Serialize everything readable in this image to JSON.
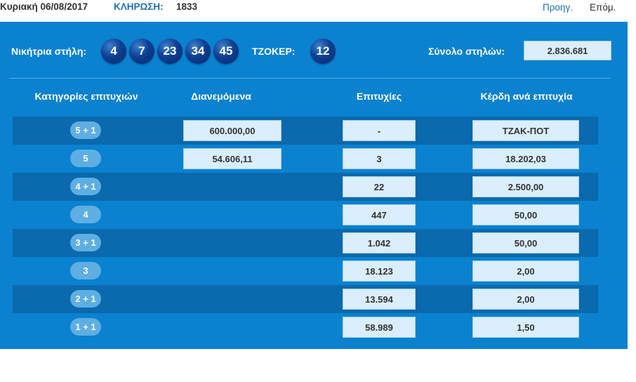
{
  "header": {
    "date": "Κυριακή 06/08/2017",
    "draw_label": "ΚΛΗΡΩΣΗ:",
    "draw_number": "1833",
    "prev_label": "Προηγ.",
    "next_label": "Επόμ."
  },
  "winning": {
    "label": "Νικήτρια στήλη:",
    "numbers": [
      "4",
      "7",
      "23",
      "34",
      "45"
    ],
    "joker_label": "ΤΖΟΚΕΡ:",
    "joker": "12",
    "total_label": "Σύνολο στηλών:",
    "total_value": "2.836.681"
  },
  "table": {
    "headers": [
      "Κατηγορίες επιτυχιών",
      "Διανεμόμενα",
      "Επιτυχίες",
      "Κέρδη ανά επιτυχία"
    ],
    "rows": [
      {
        "category": "5 + 1",
        "distributed": "600.000,00",
        "winners": "-",
        "prize": "ΤΖΑΚ-ΠΟΤ"
      },
      {
        "category": "5",
        "distributed": "54.606,11",
        "winners": "3",
        "prize": "18.202,03"
      },
      {
        "category": "4 + 1",
        "winners": "22",
        "prize": "2.500,00"
      },
      {
        "category": "4",
        "winners": "447",
        "prize": "50,00"
      },
      {
        "category": "3 + 1",
        "winners": "1.042",
        "prize": "50,00"
      },
      {
        "category": "3",
        "winners": "18.123",
        "prize": "2,00"
      },
      {
        "category": "2 + 1",
        "winners": "13.594",
        "prize": "2,00"
      },
      {
        "category": "1 + 1",
        "winners": "58.989",
        "prize": "1,50"
      }
    ]
  },
  "colors": {
    "panel": "#0a82cf",
    "row_dark": "#0b69ad",
    "ball": "#0d3f94",
    "cell": "#daeefd",
    "link": "#1f6fb5"
  }
}
